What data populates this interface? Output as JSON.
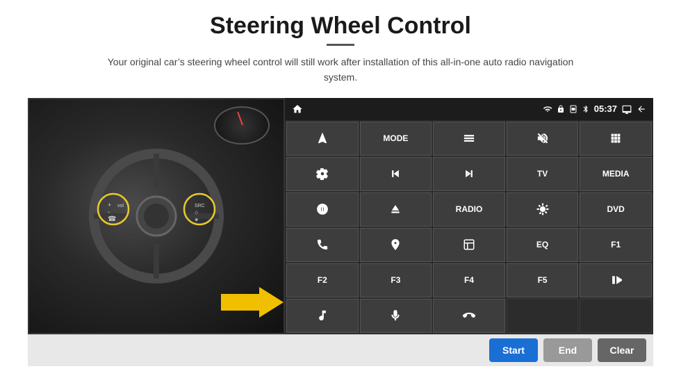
{
  "header": {
    "title": "Steering Wheel Control",
    "underline": true,
    "subtitle": "Your original car’s steering wheel control will still work after installation of this all-in-one auto radio navigation system."
  },
  "statusbar": {
    "time": "05:37",
    "icons": [
      "wifi",
      "lock",
      "sim",
      "bluetooth",
      "battery",
      "screen",
      "back"
    ]
  },
  "grid_buttons": [
    {
      "id": "r1c1",
      "type": "icon",
      "icon": "navigate",
      "label": ""
    },
    {
      "id": "r1c2",
      "type": "text",
      "label": "MODE"
    },
    {
      "id": "r1c3",
      "type": "icon",
      "icon": "list",
      "label": ""
    },
    {
      "id": "r1c4",
      "type": "icon",
      "icon": "mute",
      "label": ""
    },
    {
      "id": "r1c5",
      "type": "icon",
      "icon": "apps",
      "label": ""
    },
    {
      "id": "r2c1",
      "type": "icon",
      "icon": "settings-circle",
      "label": ""
    },
    {
      "id": "r2c2",
      "type": "icon",
      "icon": "rewind",
      "label": ""
    },
    {
      "id": "r2c3",
      "type": "icon",
      "icon": "forward",
      "label": ""
    },
    {
      "id": "r2c4",
      "type": "text",
      "label": "TV"
    },
    {
      "id": "r2c5",
      "type": "text",
      "label": "MEDIA"
    },
    {
      "id": "r3c1",
      "type": "icon",
      "icon": "360-car",
      "label": ""
    },
    {
      "id": "r3c2",
      "type": "icon",
      "icon": "eject",
      "label": ""
    },
    {
      "id": "r3c3",
      "type": "text",
      "label": "RADIO"
    },
    {
      "id": "r3c4",
      "type": "icon",
      "icon": "brightness",
      "label": ""
    },
    {
      "id": "r3c5",
      "type": "text",
      "label": "DVD"
    },
    {
      "id": "r4c1",
      "type": "icon",
      "icon": "phone",
      "label": ""
    },
    {
      "id": "r4c2",
      "type": "icon",
      "icon": "navigation-circle",
      "label": ""
    },
    {
      "id": "r4c3",
      "type": "icon",
      "icon": "window",
      "label": ""
    },
    {
      "id": "r4c4",
      "type": "text",
      "label": "EQ"
    },
    {
      "id": "r4c5",
      "type": "text",
      "label": "F1"
    },
    {
      "id": "r5c1",
      "type": "text",
      "label": "F2"
    },
    {
      "id": "r5c2",
      "type": "text",
      "label": "F3"
    },
    {
      "id": "r5c3",
      "type": "text",
      "label": "F4"
    },
    {
      "id": "r5c4",
      "type": "text",
      "label": "F5"
    },
    {
      "id": "r5c5",
      "type": "icon",
      "icon": "play-pause",
      "label": ""
    },
    {
      "id": "r6c1",
      "type": "icon",
      "icon": "music",
      "label": ""
    },
    {
      "id": "r6c2",
      "type": "icon",
      "icon": "microphone",
      "label": ""
    },
    {
      "id": "r6c3",
      "type": "icon",
      "icon": "call-end",
      "label": ""
    },
    {
      "id": "r6c4",
      "type": "empty",
      "label": ""
    },
    {
      "id": "r6c5",
      "type": "empty",
      "label": ""
    }
  ],
  "bottom_buttons": {
    "start_label": "Start",
    "end_label": "End",
    "clear_label": "Clear"
  }
}
